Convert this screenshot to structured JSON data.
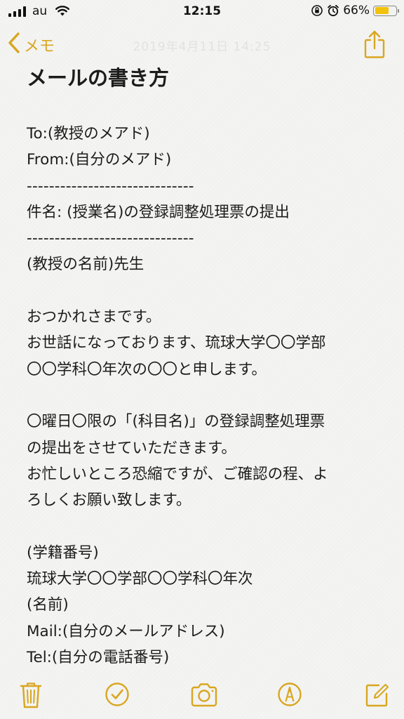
{
  "status_bar": {
    "carrier": "au",
    "time": "12:15",
    "battery_percent": "66%",
    "battery_level": 0.66,
    "icons": [
      "signal-icon",
      "wifi-icon",
      "orientation-lock-icon",
      "alarm-icon",
      "battery-icon"
    ]
  },
  "nav": {
    "back_label": "メモ",
    "faint_date": "2019年4月11日 14:25",
    "share_icon": "share-icon"
  },
  "note": {
    "title": "メールの書き方",
    "lines": [
      "To:(教授のメアド)",
      "From:(自分のメアド)",
      "------------------------------",
      "件名: (授業名)の登録調整処理票の提出",
      "------------------------------",
      "(教授の名前)先生",
      "",
      "おつかれさまです。",
      "お世話になっております、琉球大学〇〇学部",
      "〇〇学科〇年次の〇〇と申します。",
      "",
      "〇曜日〇限の「(科目名)」の登録調整処理票",
      "の提出をさせていただきます。",
      "お忙しいところ恐縮ですが、ご確認の程、よ",
      "ろしくお願い致します。",
      "",
      "(学籍番号)",
      "琉球大学〇〇学部〇〇学科〇年次",
      "(名前)",
      "Mail:(自分のメールアドレス)",
      "Tel:(自分の電話番号)"
    ]
  },
  "toolbar": {
    "items": [
      "trash-icon",
      "checklist-icon",
      "camera-icon",
      "markup-icon",
      "compose-icon"
    ]
  },
  "colors": {
    "accent": "#d9a620",
    "background": "#f4f4f2",
    "text": "#1c1c1c",
    "battery": "#f2c20c"
  }
}
